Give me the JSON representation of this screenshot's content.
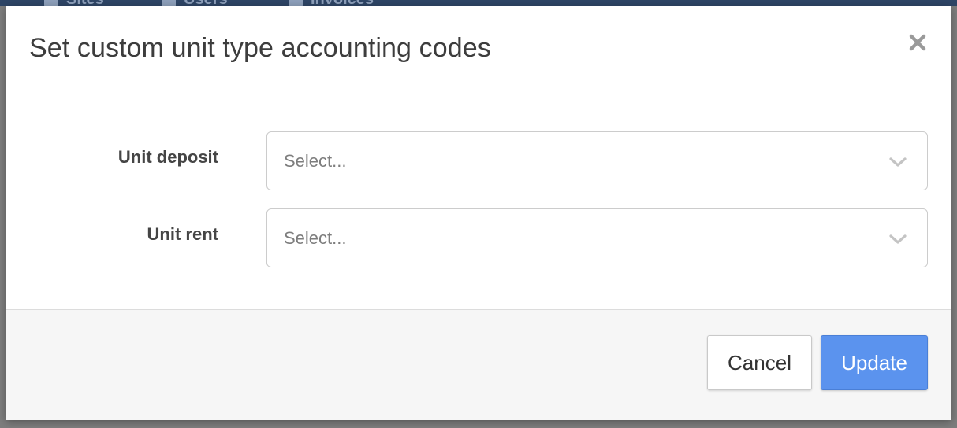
{
  "background": {
    "nav_tabs": [
      {
        "label": "Sites"
      },
      {
        "label": "Users"
      },
      {
        "label": "Invoices"
      }
    ]
  },
  "modal": {
    "title": "Set custom unit type accounting codes",
    "close_icon": "close-icon",
    "fields": [
      {
        "label": "Unit deposit",
        "placeholder": "Select...",
        "icon": "chevron-down-icon"
      },
      {
        "label": "Unit rent",
        "placeholder": "Select...",
        "icon": "chevron-down-icon"
      }
    ],
    "footer": {
      "cancel_label": "Cancel",
      "update_label": "Update"
    }
  },
  "colors": {
    "primary_button": "#5b93ee",
    "nav_background": "#2e4566"
  }
}
